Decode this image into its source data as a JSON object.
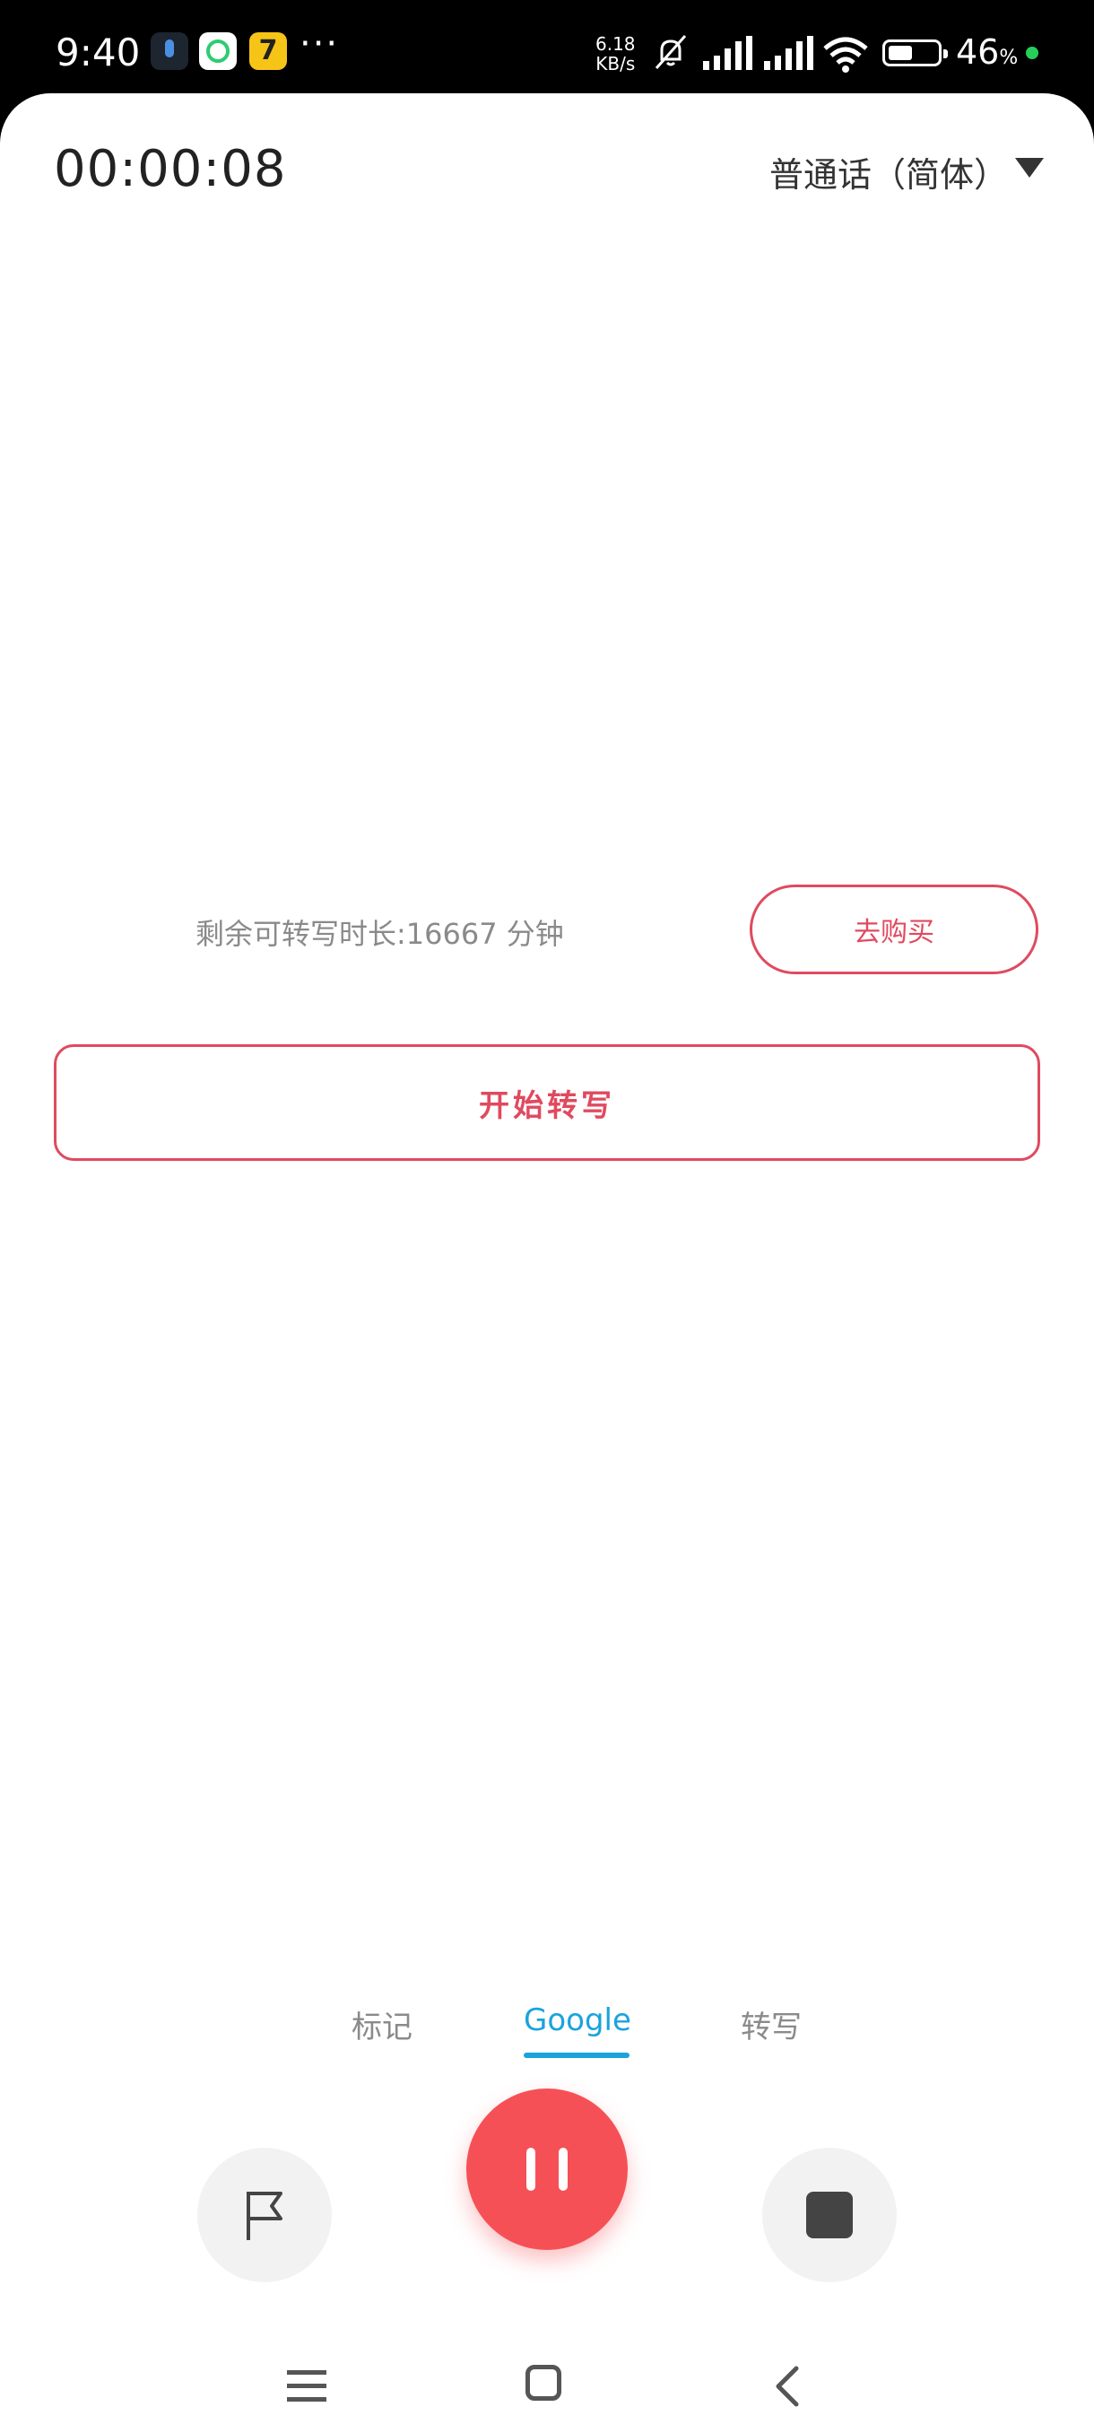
{
  "status_bar": {
    "time": "9:40",
    "more": "···",
    "net_speed_value": "6.18",
    "net_speed_unit": "KB/s",
    "battery_level": "46",
    "battery_unit": "%",
    "app_seven": "7"
  },
  "header": {
    "timer": "00:00:08",
    "language": "普通话（简体）"
  },
  "transcribe": {
    "remaining_text": "剩余可转写时长:16667 分钟",
    "buy_label": "去购买",
    "start_label": "开始转写"
  },
  "tabs": [
    {
      "label": "标记"
    },
    {
      "label": "Google",
      "selected": true
    },
    {
      "label": "转写"
    }
  ],
  "colors": {
    "accent_red": "#e04a5f",
    "record_red": "#f65057",
    "tab_selected_blue": "#1aa3dc"
  },
  "icons": [
    "flag-icon",
    "pause-icon",
    "stop-icon",
    "menu-icon",
    "home-icon",
    "back-icon"
  ]
}
